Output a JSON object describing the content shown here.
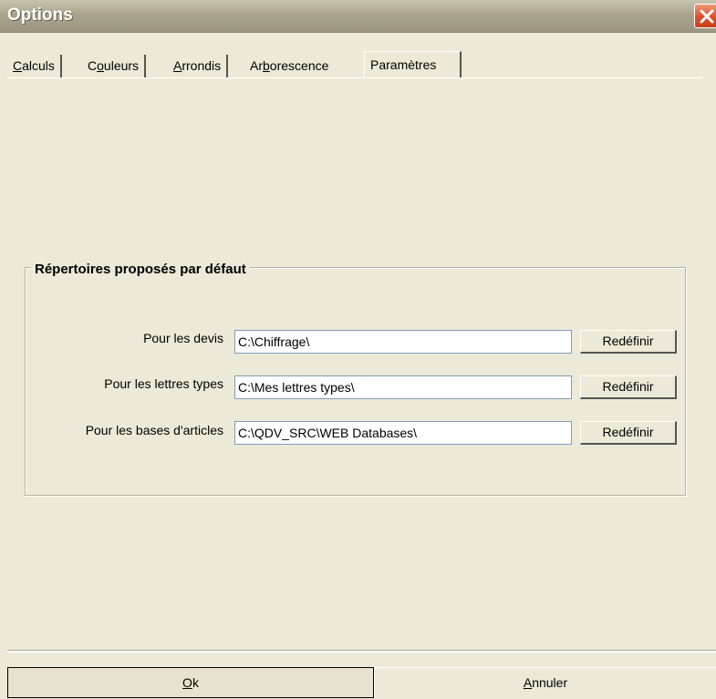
{
  "window": {
    "title": "Options"
  },
  "tabs": [
    {
      "label": "Calculs",
      "mnemonic": "C",
      "rest": "alculs",
      "active": false
    },
    {
      "label": "Couleurs",
      "mnemonic": "o",
      "pre": "C",
      "rest": "uleurs",
      "active": false
    },
    {
      "label": "Arrondis",
      "mnemonic": "A",
      "rest": "rrondis",
      "active": false
    },
    {
      "label": "Arborescence",
      "pre": "Ar",
      "mnemonic": "b",
      "rest": "orescence",
      "active": false
    },
    {
      "label": "Paramètres",
      "active": true
    }
  ],
  "group": {
    "title": "Répertoires proposés par défaut",
    "rows": [
      {
        "label": "Pour les devis",
        "value": "C:\\Chiffrage\\",
        "button": "Redéfinir"
      },
      {
        "label": "Pour les lettres types",
        "value": "C:\\Mes lettres types\\",
        "button": "Redéfinir"
      },
      {
        "label": "Pour les bases d'articles",
        "value": "C:\\QDV_SRC\\WEB Databases\\",
        "button": "Redéfinir"
      }
    ]
  },
  "footer": {
    "ok_mnemonic": "O",
    "ok_rest": "k",
    "cancel_mnemonic": "A",
    "cancel_rest": "nnuler"
  }
}
